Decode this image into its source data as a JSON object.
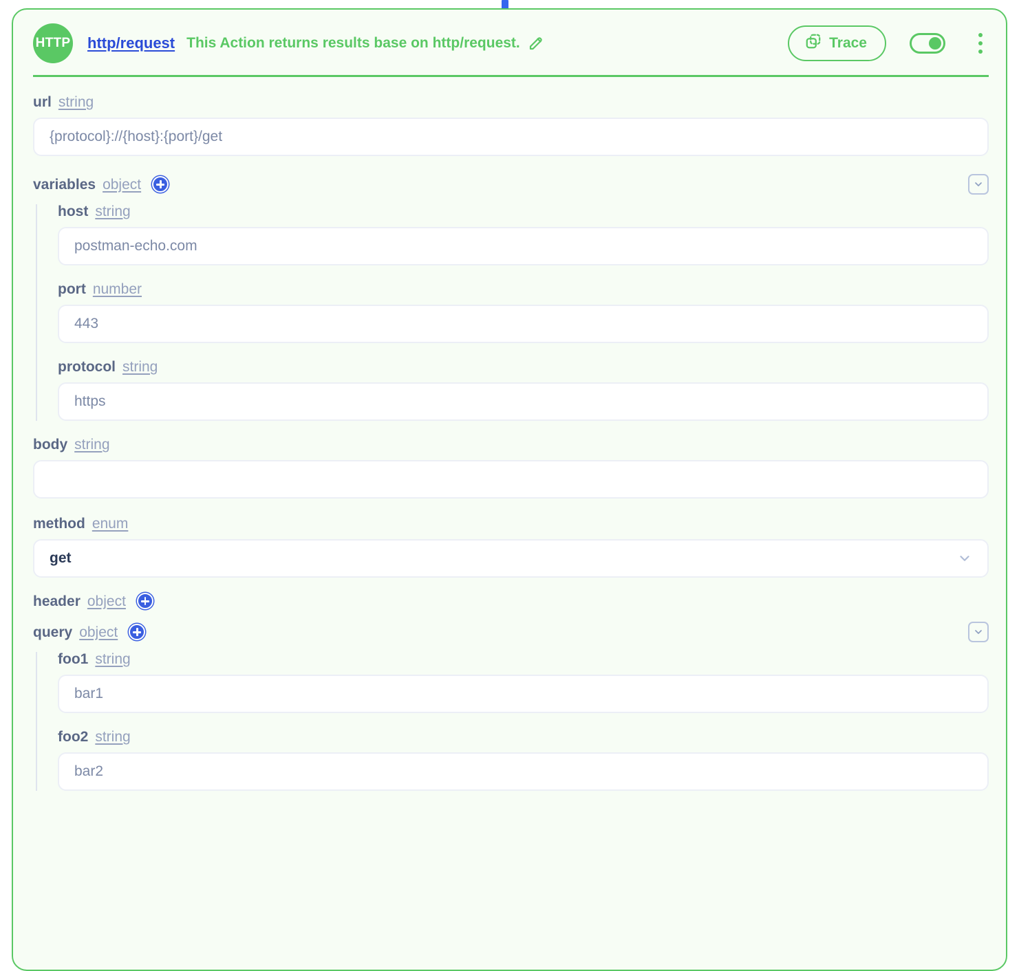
{
  "card": {
    "badge_label": "HTTP",
    "action_name": "http/request",
    "action_description": "This Action returns results base on http/request.",
    "trace_label": "Trace",
    "toggle_state": "on",
    "accent_green": "#5ac864",
    "accent_blue": "#3a5fe0",
    "link_blue": "#2a4bd7",
    "card_background": "#f7fdf5"
  },
  "fields": {
    "url": {
      "name": "url",
      "type": "string",
      "value": "{protocol}://{host}:{port}/get"
    },
    "variables": {
      "name": "variables",
      "type": "object",
      "children": [
        {
          "name": "host",
          "type": "string",
          "value": "postman-echo.com"
        },
        {
          "name": "port",
          "type": "number",
          "value": "443"
        },
        {
          "name": "protocol",
          "type": "string",
          "value": "https"
        }
      ]
    },
    "body": {
      "name": "body",
      "type": "string",
      "value": ""
    },
    "method": {
      "name": "method",
      "type": "enum",
      "value": "get"
    },
    "header": {
      "name": "header",
      "type": "object"
    },
    "query": {
      "name": "query",
      "type": "object",
      "children": [
        {
          "name": "foo1",
          "type": "string",
          "value": "bar1"
        },
        {
          "name": "foo2",
          "type": "string",
          "value": "bar2"
        }
      ]
    }
  }
}
